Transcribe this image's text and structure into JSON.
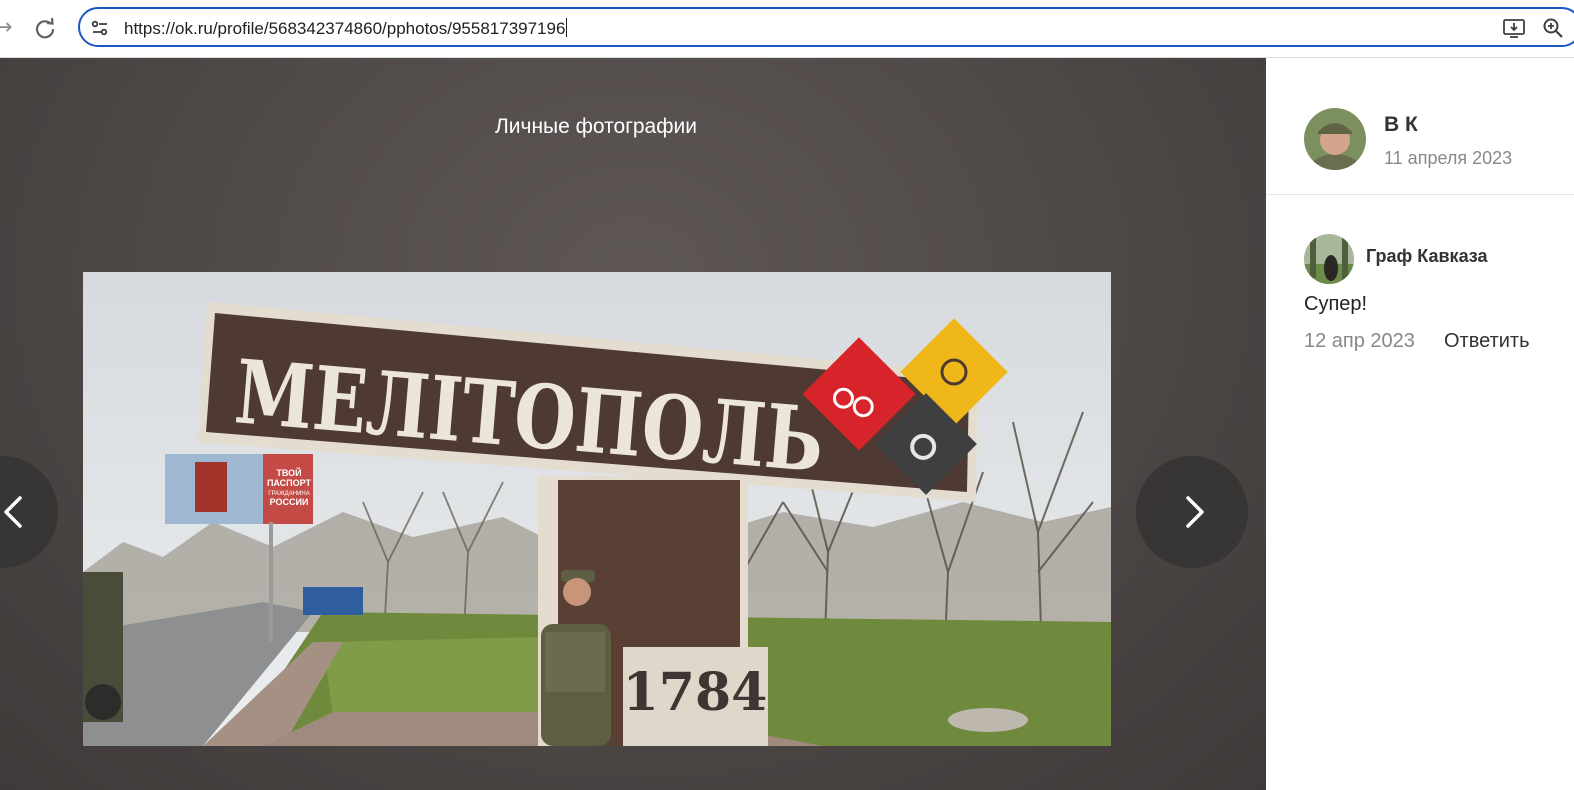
{
  "browser": {
    "url": "https://ok.ru/profile/568342374860/pphotos/955817397196"
  },
  "viewer": {
    "album_title": "Личные фотографии",
    "photo": {
      "sign_text": "МЕЛІТОПОЛЬ",
      "year_text": "1784",
      "billboard_lines": [
        "ТВОЙ",
        "ПАСПОРТ",
        "ГРАЖДАНИНА",
        "РОССИИ"
      ]
    }
  },
  "author": {
    "name": "В К",
    "date": "11 апреля 2023"
  },
  "comments": [
    {
      "author": "Граф Кавказа",
      "text": "Супер!",
      "date": "12 апр 2023",
      "reply_label": "Ответить"
    }
  ],
  "colors": {
    "accent_border": "#1a57c5",
    "viewer_bg": "#4d4746",
    "sign_brown": "#4e3a32",
    "cherry_red": "#d7242a",
    "honey_yellow": "#f0b71a"
  }
}
